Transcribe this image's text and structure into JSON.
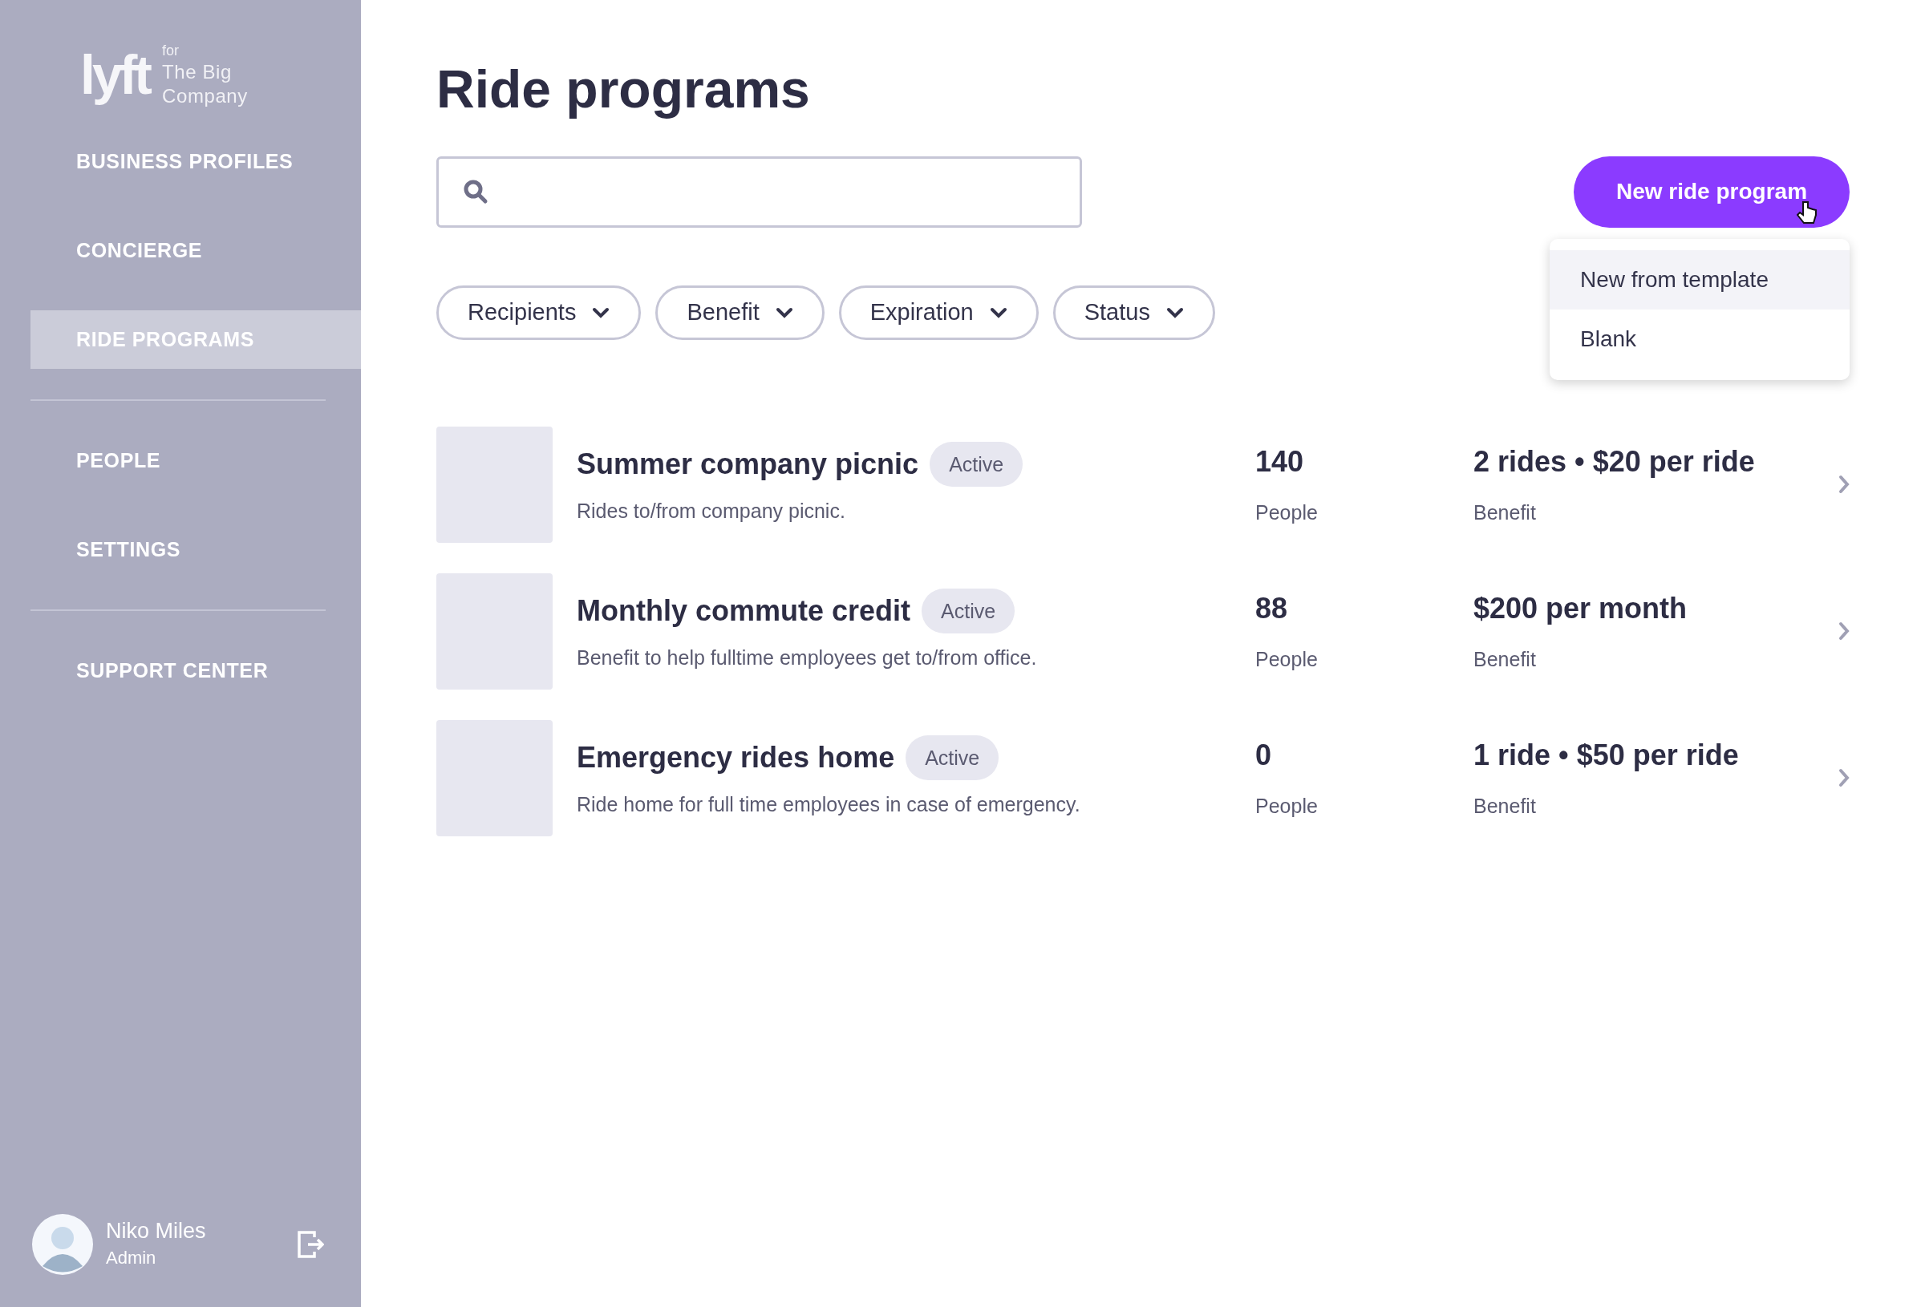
{
  "brand": {
    "logo": "lyft",
    "for": "for",
    "company": "The Big Company"
  },
  "nav": [
    [
      {
        "label": "BUSINESS PROFILES",
        "selected": false
      },
      {
        "label": "CONCIERGE",
        "selected": false
      },
      {
        "label": "RIDE PROGRAMS",
        "selected": true
      }
    ],
    [
      {
        "label": "PEOPLE",
        "selected": false
      },
      {
        "label": "SETTINGS",
        "selected": false
      }
    ],
    [
      {
        "label": "SUPPORT CENTER",
        "selected": false
      }
    ]
  ],
  "user": {
    "name": "Niko Miles",
    "role": "Admin"
  },
  "title": "Ride programs",
  "new_button": "New ride program",
  "menu": [
    {
      "label": "New from template",
      "selected": true
    },
    {
      "label": "Blank",
      "selected": false
    }
  ],
  "filters": [
    "Recipients",
    "Benefit",
    "Expiration",
    "Status"
  ],
  "programs": [
    {
      "name": "Summer company picnic",
      "status": "Active",
      "description": "Rides to/from company picnic.",
      "people": "140",
      "people_label": "People",
      "benefit": "2 rides • $20 per ride",
      "benefit_label": "Benefit"
    },
    {
      "name": "Monthly commute credit",
      "status": "Active",
      "description": "Benefit to help fulltime employees get to/from office.",
      "people": "88",
      "people_label": "People",
      "benefit": "$200 per month",
      "benefit_label": "Benefit"
    },
    {
      "name": "Emergency rides home",
      "status": "Active",
      "description": "Ride home for full time employees in case of emergency.",
      "people": "0",
      "people_label": "People",
      "benefit": "1 ride • $50 per ride",
      "benefit_label": "Benefit"
    }
  ]
}
